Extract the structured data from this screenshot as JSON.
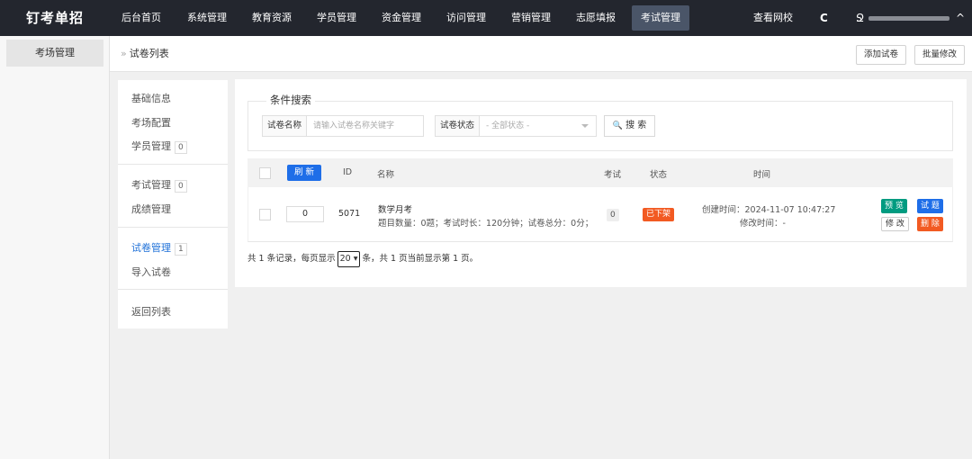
{
  "brand": "钉考单招",
  "nav": {
    "items": [
      "后台首页",
      "系统管理",
      "教育资源",
      "学员管理",
      "资金管理",
      "访问管理",
      "营销管理",
      "志愿填报",
      "考试管理"
    ],
    "active": "考试管理",
    "view_site": "查看网校",
    "refresh_icon": "C",
    "user_icon": "Ջ",
    "caret_icon": "^"
  },
  "module_sidebar": {
    "item": "考场管理"
  },
  "header": {
    "breadcrumb_sep": "»",
    "breadcrumb": "试卷列表",
    "add_button": "添加试卷",
    "batch_button": "批量修改"
  },
  "submenu": {
    "basic_info": "基础信息",
    "room_config": "考场配置",
    "student_mgmt": "学员管理",
    "student_count": "0",
    "exam_mgmt": "考试管理",
    "exam_count": "0",
    "score_mgmt": "成绩管理",
    "paper_mgmt": "试卷管理",
    "paper_count": "1",
    "import_paper": "导入试卷",
    "back_list": "返回列表"
  },
  "search": {
    "legend": "条件搜索",
    "name_label": "试卷名称",
    "name_placeholder": "请输入试卷名称关键字",
    "status_label": "试卷状态",
    "status_value": "- 全部状态 -",
    "button_icon": "🔍",
    "button": "搜 索"
  },
  "table": {
    "refresh_button": "刷 新",
    "headers": {
      "id": "ID",
      "name": "名称",
      "exam": "考试",
      "status": "状态",
      "time": "时间"
    },
    "rows": [
      {
        "sort": "0",
        "id": "5071",
        "name": "数学月考",
        "detail": "题目数量：0题；考试时长：120分钟；试卷总分：0分；",
        "exam_count": "0",
        "status": "已下架",
        "created": "创建时间：2024-11-07 10:47:27",
        "modified": "修改时间：-",
        "ops": {
          "preview": "预 览",
          "questions": "试 题",
          "edit": "修 改",
          "delete": "删 除"
        }
      }
    ]
  },
  "pager": {
    "prefix": "共 1 条记录，每页显示",
    "page_size": "20",
    "suffix": "条，共 1 页当前显示第 1 页。"
  },
  "colors": {
    "topbar": "#23262e",
    "primary": "#1e6ee8",
    "danger": "#f25a22",
    "teal": "#009b80"
  }
}
